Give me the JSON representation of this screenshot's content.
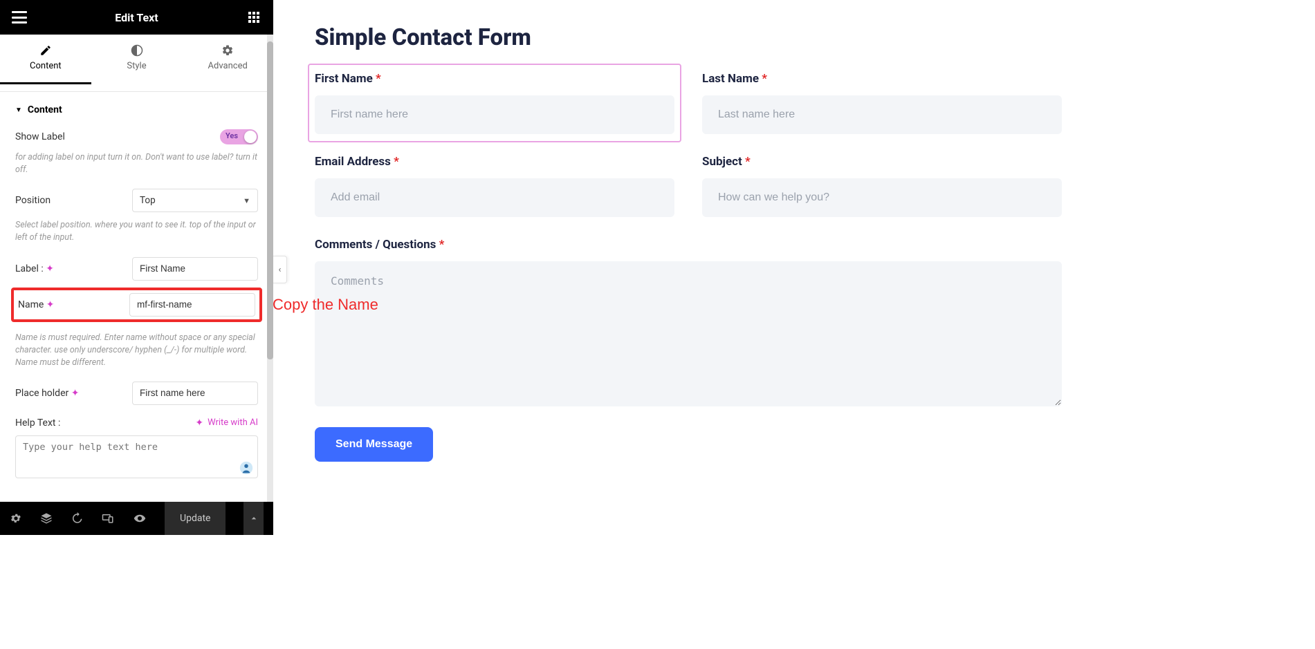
{
  "header": {
    "title": "Edit Text"
  },
  "tabs": {
    "content": "Content",
    "style": "Style",
    "advanced": "Advanced"
  },
  "section": {
    "heading": "Content"
  },
  "showLabel": {
    "label": "Show Label",
    "value": "Yes",
    "help": "for adding label on input turn it on. Don't want to use label? turn it off."
  },
  "position": {
    "label": "Position",
    "value": "Top",
    "help": "Select label position. where you want to see it. top of the input or left of the input."
  },
  "labelField": {
    "label": "Label :",
    "value": "First Name"
  },
  "nameField": {
    "label": "Name",
    "value": "mf-first-name",
    "help": "Name is must required. Enter name without space or any special character. use only underscore/ hyphen (_/-) for multiple word. Name must be different."
  },
  "placeholderField": {
    "label": "Place holder",
    "value": "First name here"
  },
  "helpText": {
    "label": "Help Text :",
    "ai": "Write with AI",
    "placeholder": "Type your help text here"
  },
  "bottom": {
    "update": "Update"
  },
  "annotation": "Copy the Name",
  "preview": {
    "title": "Simple Contact Form",
    "firstName": {
      "label": "First Name",
      "placeholder": "First name here"
    },
    "lastName": {
      "label": "Last Name",
      "placeholder": "Last name here"
    },
    "email": {
      "label": "Email Address",
      "placeholder": "Add email"
    },
    "subject": {
      "label": "Subject",
      "placeholder": "How can we help you?"
    },
    "comments": {
      "label": "Comments / Questions",
      "placeholder": "Comments"
    },
    "submit": "Send Message"
  }
}
